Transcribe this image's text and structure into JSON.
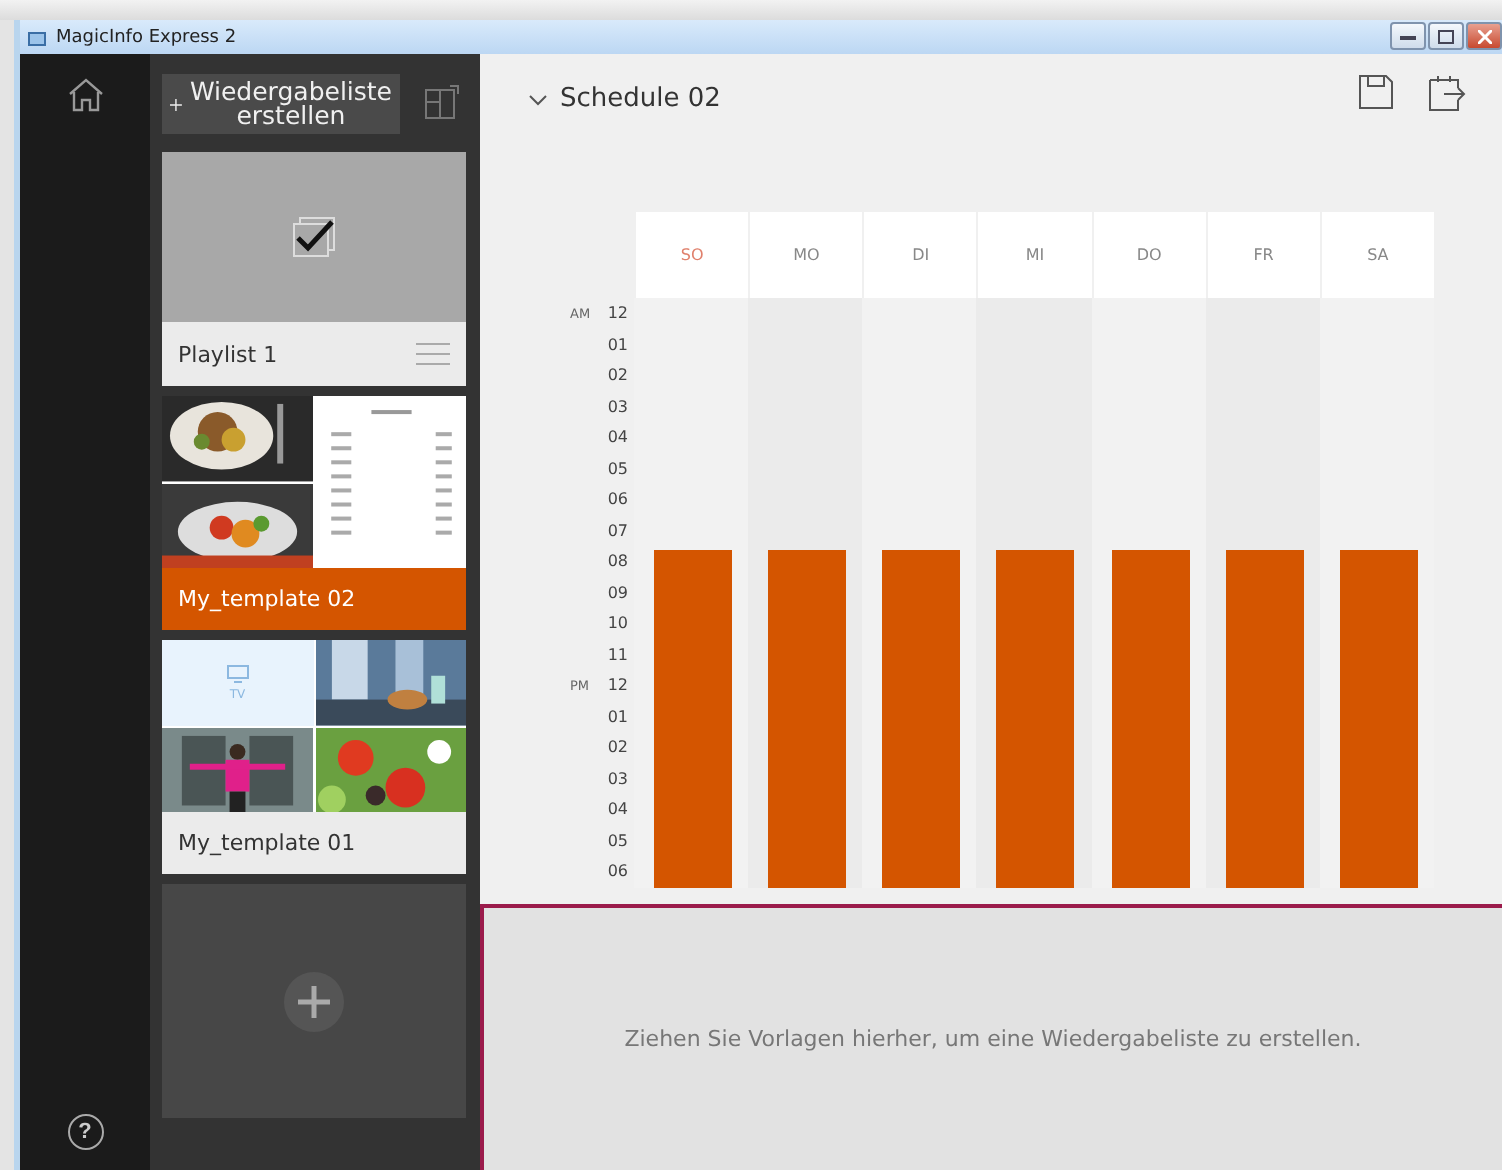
{
  "window": {
    "title": "MagicInfo Express 2"
  },
  "nav": {
    "help": "?"
  },
  "playlist_panel": {
    "create_button": "Wiedergabeliste erstellen",
    "cards": [
      {
        "kind": "playlist",
        "title": "Playlist 1",
        "selected": false,
        "checked": true
      },
      {
        "kind": "menu_template",
        "title": "My_template 02",
        "selected": true
      },
      {
        "kind": "grid_template",
        "title": "My_template 01",
        "selected": false,
        "tv_label": "TV"
      }
    ]
  },
  "schedule": {
    "title": "Schedule 02",
    "expanded": true,
    "days": [
      {
        "label": "SO",
        "color": "#e0806c"
      },
      {
        "label": "MO",
        "color": "#888888"
      },
      {
        "label": "DI",
        "color": "#888888"
      },
      {
        "label": "MI",
        "color": "#888888"
      },
      {
        "label": "DO",
        "color": "#888888"
      },
      {
        "label": "FR",
        "color": "#888888"
      },
      {
        "label": "SA",
        "color": "#888888"
      }
    ],
    "hours": [
      {
        "label": "12",
        "meridiem": "AM",
        "scheduled": false
      },
      {
        "label": "01",
        "scheduled": false
      },
      {
        "label": "02",
        "scheduled": false
      },
      {
        "label": "03",
        "scheduled": false
      },
      {
        "label": "04",
        "scheduled": false
      },
      {
        "label": "05",
        "scheduled": false
      },
      {
        "label": "06",
        "scheduled": false
      },
      {
        "label": "07",
        "scheduled": false
      },
      {
        "label": "08",
        "scheduled": true
      },
      {
        "label": "09",
        "scheduled": true
      },
      {
        "label": "10",
        "scheduled": true
      },
      {
        "label": "11",
        "scheduled": true
      },
      {
        "label": "12",
        "meridiem": "PM",
        "scheduled": true
      },
      {
        "label": "01",
        "scheduled": true
      },
      {
        "label": "02",
        "scheduled": true
      },
      {
        "label": "03",
        "scheduled": true
      },
      {
        "label": "04",
        "scheduled": true
      },
      {
        "label": "05",
        "scheduled": true
      },
      {
        "label": "06",
        "scheduled": true
      }
    ]
  },
  "drop_zone": {
    "text": "Ziehen Sie Vorlagen hierher, um eine Wiedergabeliste zu erstellen."
  }
}
